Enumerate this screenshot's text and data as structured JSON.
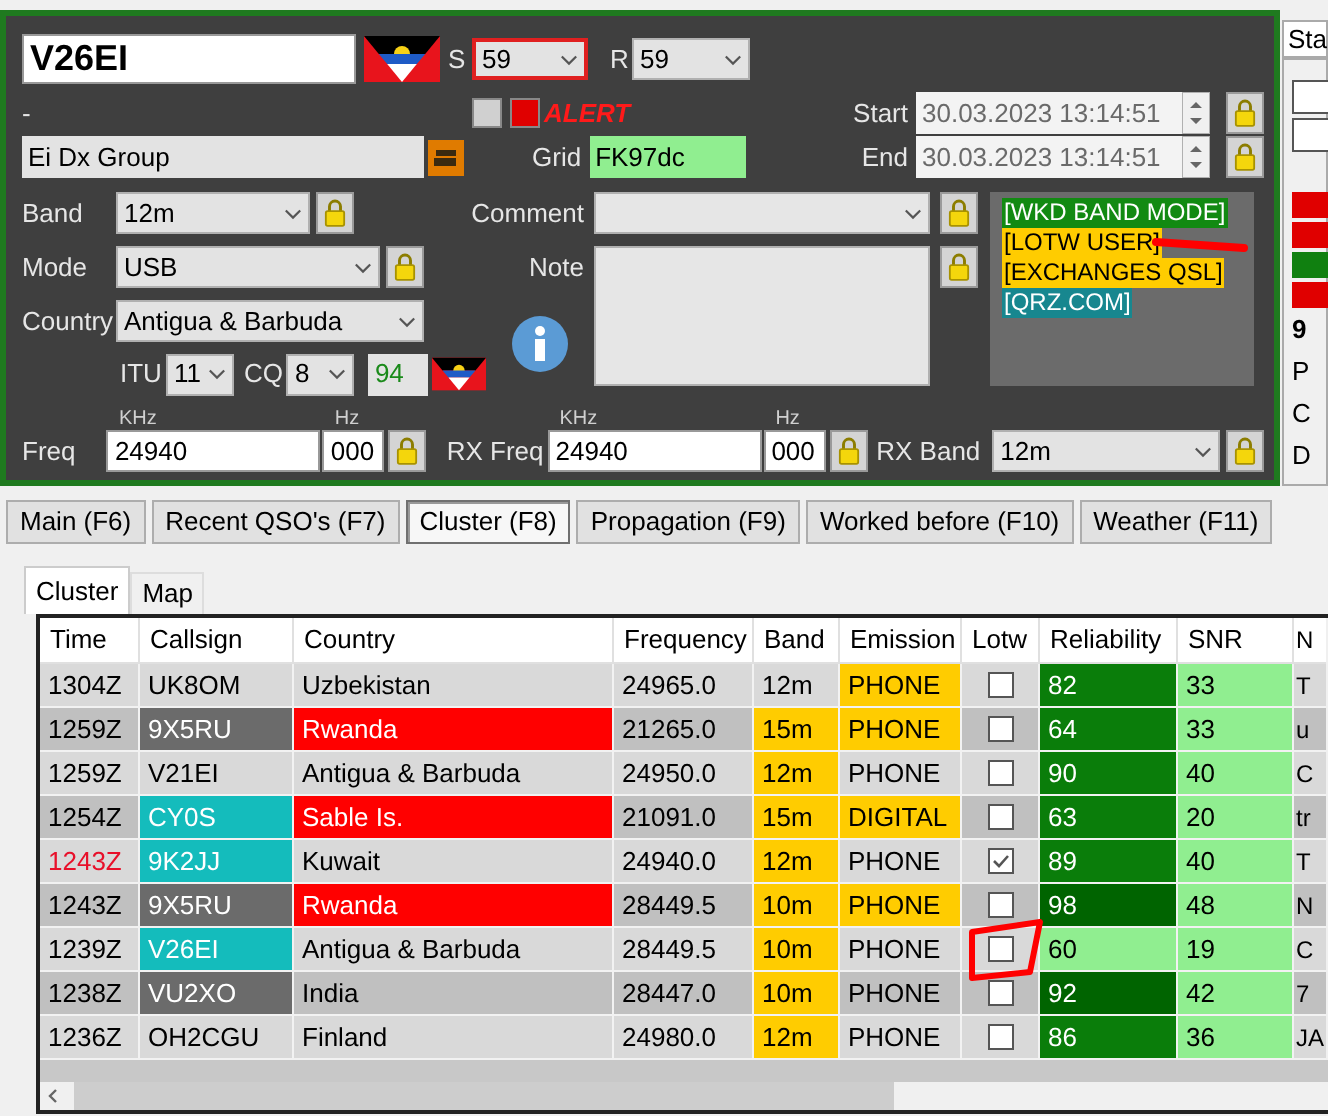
{
  "entry": {
    "callsign": "V26EI",
    "s_label": "S",
    "s_value": "59",
    "r_label": "R",
    "r_value": "59",
    "dash": "-",
    "alert": "ALERT",
    "start_label": "Start",
    "start": "30.03.2023 13:14:51",
    "end_label": "End",
    "end": "30.03.2023 13:14:51",
    "name": "Ei Dx Group",
    "grid_label": "Grid",
    "grid": "FK97dc",
    "band_label": "Band",
    "band": "12m",
    "mode_label": "Mode",
    "mode": "USB",
    "country_label": "Country",
    "country": "Antigua & Barbuda",
    "itu_label": "ITU",
    "itu": "11",
    "cq_label": "CQ",
    "cq": "8",
    "zone": "94",
    "comment_label": "Comment",
    "note_label": "Note",
    "freq_label": "Freq",
    "freq_khz_unit": "KHz",
    "freq_hz_unit": "Hz",
    "freq_khz": "24940",
    "freq_hz": "000",
    "rx_freq_label": "RX Freq",
    "rx_khz_unit": "KHz",
    "rx_hz_unit": "Hz",
    "rx_khz": "24940",
    "rx_hz": "000",
    "rx_band_label": "RX Band",
    "rx_band": "12m"
  },
  "info_tags": [
    {
      "text": "[WKD BAND MODE]",
      "color": "#128a12"
    },
    {
      "text": "[LOTW USER]",
      "color": "#ffcc00"
    },
    {
      "text": "[EXCHANGES QSL]",
      "color": "#ffcc00"
    },
    {
      "text": "[QRZ.COM]",
      "color": "#17878f"
    }
  ],
  "side_panel": {
    "tab": "Sta",
    "indicators": [
      {
        "color": "#e00000"
      },
      {
        "color": "#e00000"
      },
      {
        "color": "#108010"
      },
      {
        "color": "#e00000"
      }
    ],
    "labels": [
      "9",
      "P",
      "C",
      "D"
    ]
  },
  "tabs": [
    {
      "label": "Main (F6)",
      "selected": false
    },
    {
      "label": "Recent QSO's (F7)",
      "selected": false
    },
    {
      "label": "Cluster (F8)",
      "selected": true
    },
    {
      "label": "Propagation (F9)",
      "selected": false
    },
    {
      "label": "Worked before (F10)",
      "selected": false
    },
    {
      "label": "Weather (F11)",
      "selected": false
    }
  ],
  "subtabs": [
    {
      "label": "Cluster",
      "selected": true
    },
    {
      "label": "Map",
      "selected": false
    }
  ],
  "table": {
    "columns": [
      "Time",
      "Callsign",
      "Country",
      "Frequency",
      "Band",
      "Emission",
      "Lotw",
      "Reliability",
      "SNR",
      "N"
    ],
    "rows": [
      {
        "time": "1304Z",
        "time_alert": false,
        "callsign": {
          "text": "UK8OM"
        },
        "country": "Uzbekistan",
        "country_alert": false,
        "frequency": "24965.0",
        "band": "12m",
        "band_highlight": false,
        "emission": "PHONE",
        "emission_highlight": true,
        "lotw": false,
        "reliability": {
          "text": "82",
          "color": "#0a7d0a"
        },
        "snr": "33",
        "column_10": "T"
      },
      {
        "time": "1259Z",
        "time_alert": false,
        "callsign": {
          "text": "9X5RU",
          "color": "#6b6b6b"
        },
        "country": "Rwanda",
        "country_alert": true,
        "frequency": "21265.0",
        "band": "15m",
        "band_highlight": true,
        "emission": "PHONE",
        "emission_highlight": true,
        "lotw": false,
        "reliability": {
          "text": "64",
          "color": "#0a7d0a"
        },
        "snr": "33",
        "column_10": "u"
      },
      {
        "time": "1259Z",
        "time_alert": false,
        "callsign": {
          "text": "V21EI"
        },
        "country": "Antigua & Barbuda",
        "country_alert": false,
        "frequency": "24950.0",
        "band": "12m",
        "band_highlight": true,
        "emission": "PHONE",
        "emission_highlight": false,
        "lotw": false,
        "reliability": {
          "text": "90",
          "color": "#0a7d0a"
        },
        "snr": "40",
        "column_10": "C"
      },
      {
        "time": "1254Z",
        "time_alert": false,
        "callsign": {
          "text": "CY0S",
          "color": "#14bcbc"
        },
        "country": "Sable Is.",
        "country_alert": true,
        "frequency": "21091.0",
        "band": "15m",
        "band_highlight": true,
        "emission": "DIGITAL",
        "emission_highlight": true,
        "lotw": false,
        "reliability": {
          "text": "63",
          "color": "#0a7d0a"
        },
        "snr": "20",
        "column_10": "tr"
      },
      {
        "time": "1243Z",
        "time_alert": true,
        "callsign": {
          "text": "9K2JJ",
          "color": "#14bcbc"
        },
        "country": "Kuwait",
        "country_alert": false,
        "frequency": "24940.0",
        "band": "12m",
        "band_highlight": true,
        "emission": "PHONE",
        "emission_highlight": false,
        "lotw": true,
        "reliability": {
          "text": "89",
          "color": "#0a7d0a"
        },
        "snr": "40",
        "column_10": "T"
      },
      {
        "time": "1243Z",
        "time_alert": false,
        "callsign": {
          "text": "9X5RU",
          "color": "#6b6b6b"
        },
        "country": "Rwanda",
        "country_alert": true,
        "frequency": "28449.5",
        "band": "10m",
        "band_highlight": true,
        "emission": "PHONE",
        "emission_highlight": true,
        "lotw": false,
        "reliability": {
          "text": "98",
          "color": "#006400"
        },
        "snr": "48",
        "column_10": "N"
      },
      {
        "time": "1239Z",
        "time_alert": false,
        "callsign": {
          "text": "V26EI",
          "color": "#14bcbc"
        },
        "country": "Antigua & Barbuda",
        "country_alert": false,
        "frequency": "28449.5",
        "band": "10m",
        "band_highlight": true,
        "emission": "PHONE",
        "emission_highlight": false,
        "lotw": false,
        "reliability": {
          "text": "60",
          "color": "#90ee90"
        },
        "snr": "19",
        "column_10": "C"
      },
      {
        "time": "1238Z",
        "time_alert": false,
        "callsign": {
          "text": "VU2XO",
          "color": "#6b6b6b"
        },
        "country": "India",
        "country_alert": false,
        "frequency": "28447.0",
        "band": "10m",
        "band_highlight": true,
        "emission": "PHONE",
        "emission_highlight": false,
        "lotw": false,
        "reliability": {
          "text": "92",
          "color": "#006400"
        },
        "snr": "42",
        "column_10": "7"
      },
      {
        "time": "1236Z",
        "time_alert": false,
        "callsign": {
          "text": "OH2CGU"
        },
        "country": "Finland",
        "country_alert": false,
        "frequency": "24980.0",
        "band": "12m",
        "band_highlight": true,
        "emission": "PHONE",
        "emission_highlight": false,
        "lotw": false,
        "reliability": {
          "text": "86",
          "color": "#0a7d0a"
        },
        "snr": "36",
        "column_10": "JA"
      }
    ]
  }
}
